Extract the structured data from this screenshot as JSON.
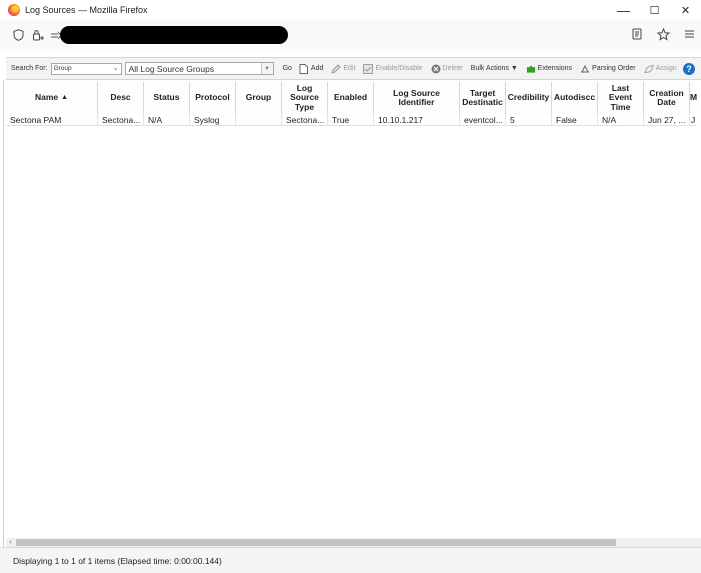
{
  "window": {
    "title": "Log Sources — Mozilla Firefox",
    "minimize_glyph": "—",
    "maximize_glyph": "☐",
    "close_glyph": "✕"
  },
  "navbar": {
    "shield_icon": "shield-icon",
    "permissions_icon": "permissions-icon",
    "reader_icon": "reader-view-icon",
    "bookmark_icon": "star-icon",
    "menu_icon": "hamburger-menu-icon"
  },
  "toolbar": {
    "search_for_label": "Search For:",
    "search_for_value": "Group",
    "group_value": "All Log Source Groups",
    "go_label": "Go",
    "add_label": "Add",
    "edit_label": "Edit",
    "enable_disable_label": "Enable/Disable",
    "delete_label": "Delete",
    "bulk_actions_label": "Bulk Actions ▼",
    "extensions_label": "Extensions",
    "parsing_order_label": "Parsing Order",
    "assign_label": "Assign",
    "help_label": "?"
  },
  "colors": {
    "help_blue": "#1b6ec2",
    "extensions_green": "#3a9d23",
    "delete_gray": "#7a7a7a"
  },
  "table": {
    "columns": [
      {
        "key": "name",
        "label": "Name"
      },
      {
        "key": "desc",
        "label": "Desc"
      },
      {
        "key": "status",
        "label": "Status"
      },
      {
        "key": "protocol",
        "label": "Protocol"
      },
      {
        "key": "group",
        "label": "Group"
      },
      {
        "key": "log_source_type",
        "label": "Log\nSource\nType"
      },
      {
        "key": "enabled",
        "label": "Enabled"
      },
      {
        "key": "log_source_identifier",
        "label": "Log Source\nIdentifier"
      },
      {
        "key": "target_destination",
        "label": "Target\nDestinatic"
      },
      {
        "key": "credibility",
        "label": "Credibility"
      },
      {
        "key": "autodiscovered",
        "label": "Autodiscc"
      },
      {
        "key": "last_event_time",
        "label": "Last\nEvent\nTime"
      },
      {
        "key": "creation_date",
        "label": "Creation\nDate"
      },
      {
        "key": "more",
        "label": "M"
      }
    ],
    "sort_indicator": "▲",
    "rows": [
      {
        "name": "Sectona PAM",
        "desc": "Sectona...",
        "status": "N/A",
        "protocol": "Syslog",
        "group": "",
        "log_source_type": "Sectona...",
        "enabled": "True",
        "log_source_identifier": "10.10.1.217",
        "target_destination": "eventcol...",
        "credibility": "5",
        "autodiscovered": "False",
        "last_event_time": "N/A",
        "creation_date": "Jun 27, ...",
        "more": "J"
      }
    ]
  },
  "status": {
    "text": "Displaying 1 to 1 of 1 items (Elapsed time: 0:00:00.144)"
  }
}
